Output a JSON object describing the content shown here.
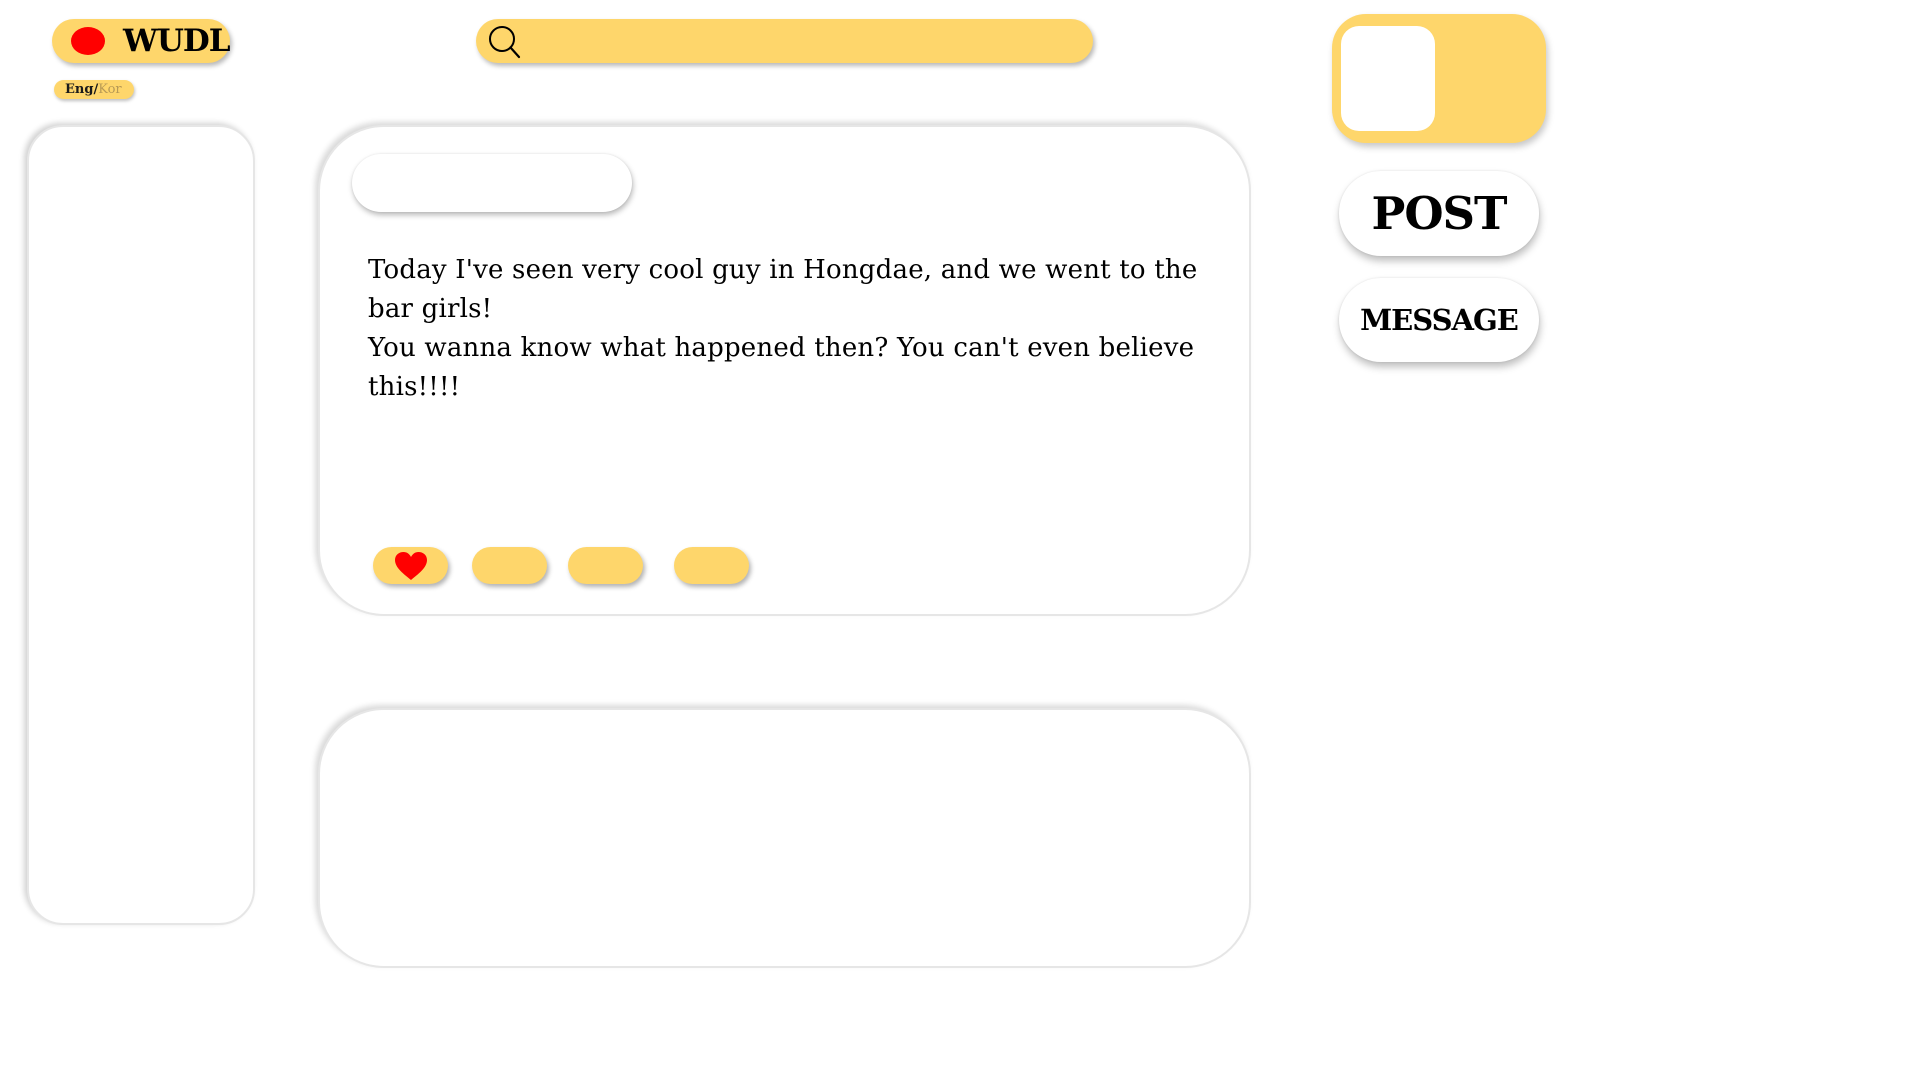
{
  "brand": {
    "name": "WUDL",
    "dot_color": "#ff0000",
    "accent_color": "#fed66b"
  },
  "language": {
    "active": "Eng",
    "separator": "/",
    "inactive": "Kor"
  },
  "search": {
    "icon": "search-icon",
    "placeholder": ""
  },
  "sidebar_right": {
    "post_label": "POST",
    "message_label": "MESSAGE"
  },
  "feed": {
    "posts": [
      {
        "title": "",
        "lines": [
          "Today I've seen very cool guy in Hongdae, and we went to the bar girls!",
          "You wanna know what happened then? You can't even believe this!!!!"
        ],
        "actions": [
          {
            "icon": "heart-icon",
            "color": "#ff0000"
          },
          {
            "icon": "",
            "label": ""
          },
          {
            "icon": "",
            "label": ""
          },
          {
            "icon": "",
            "label": ""
          }
        ]
      },
      {
        "title": "",
        "lines": []
      }
    ]
  }
}
